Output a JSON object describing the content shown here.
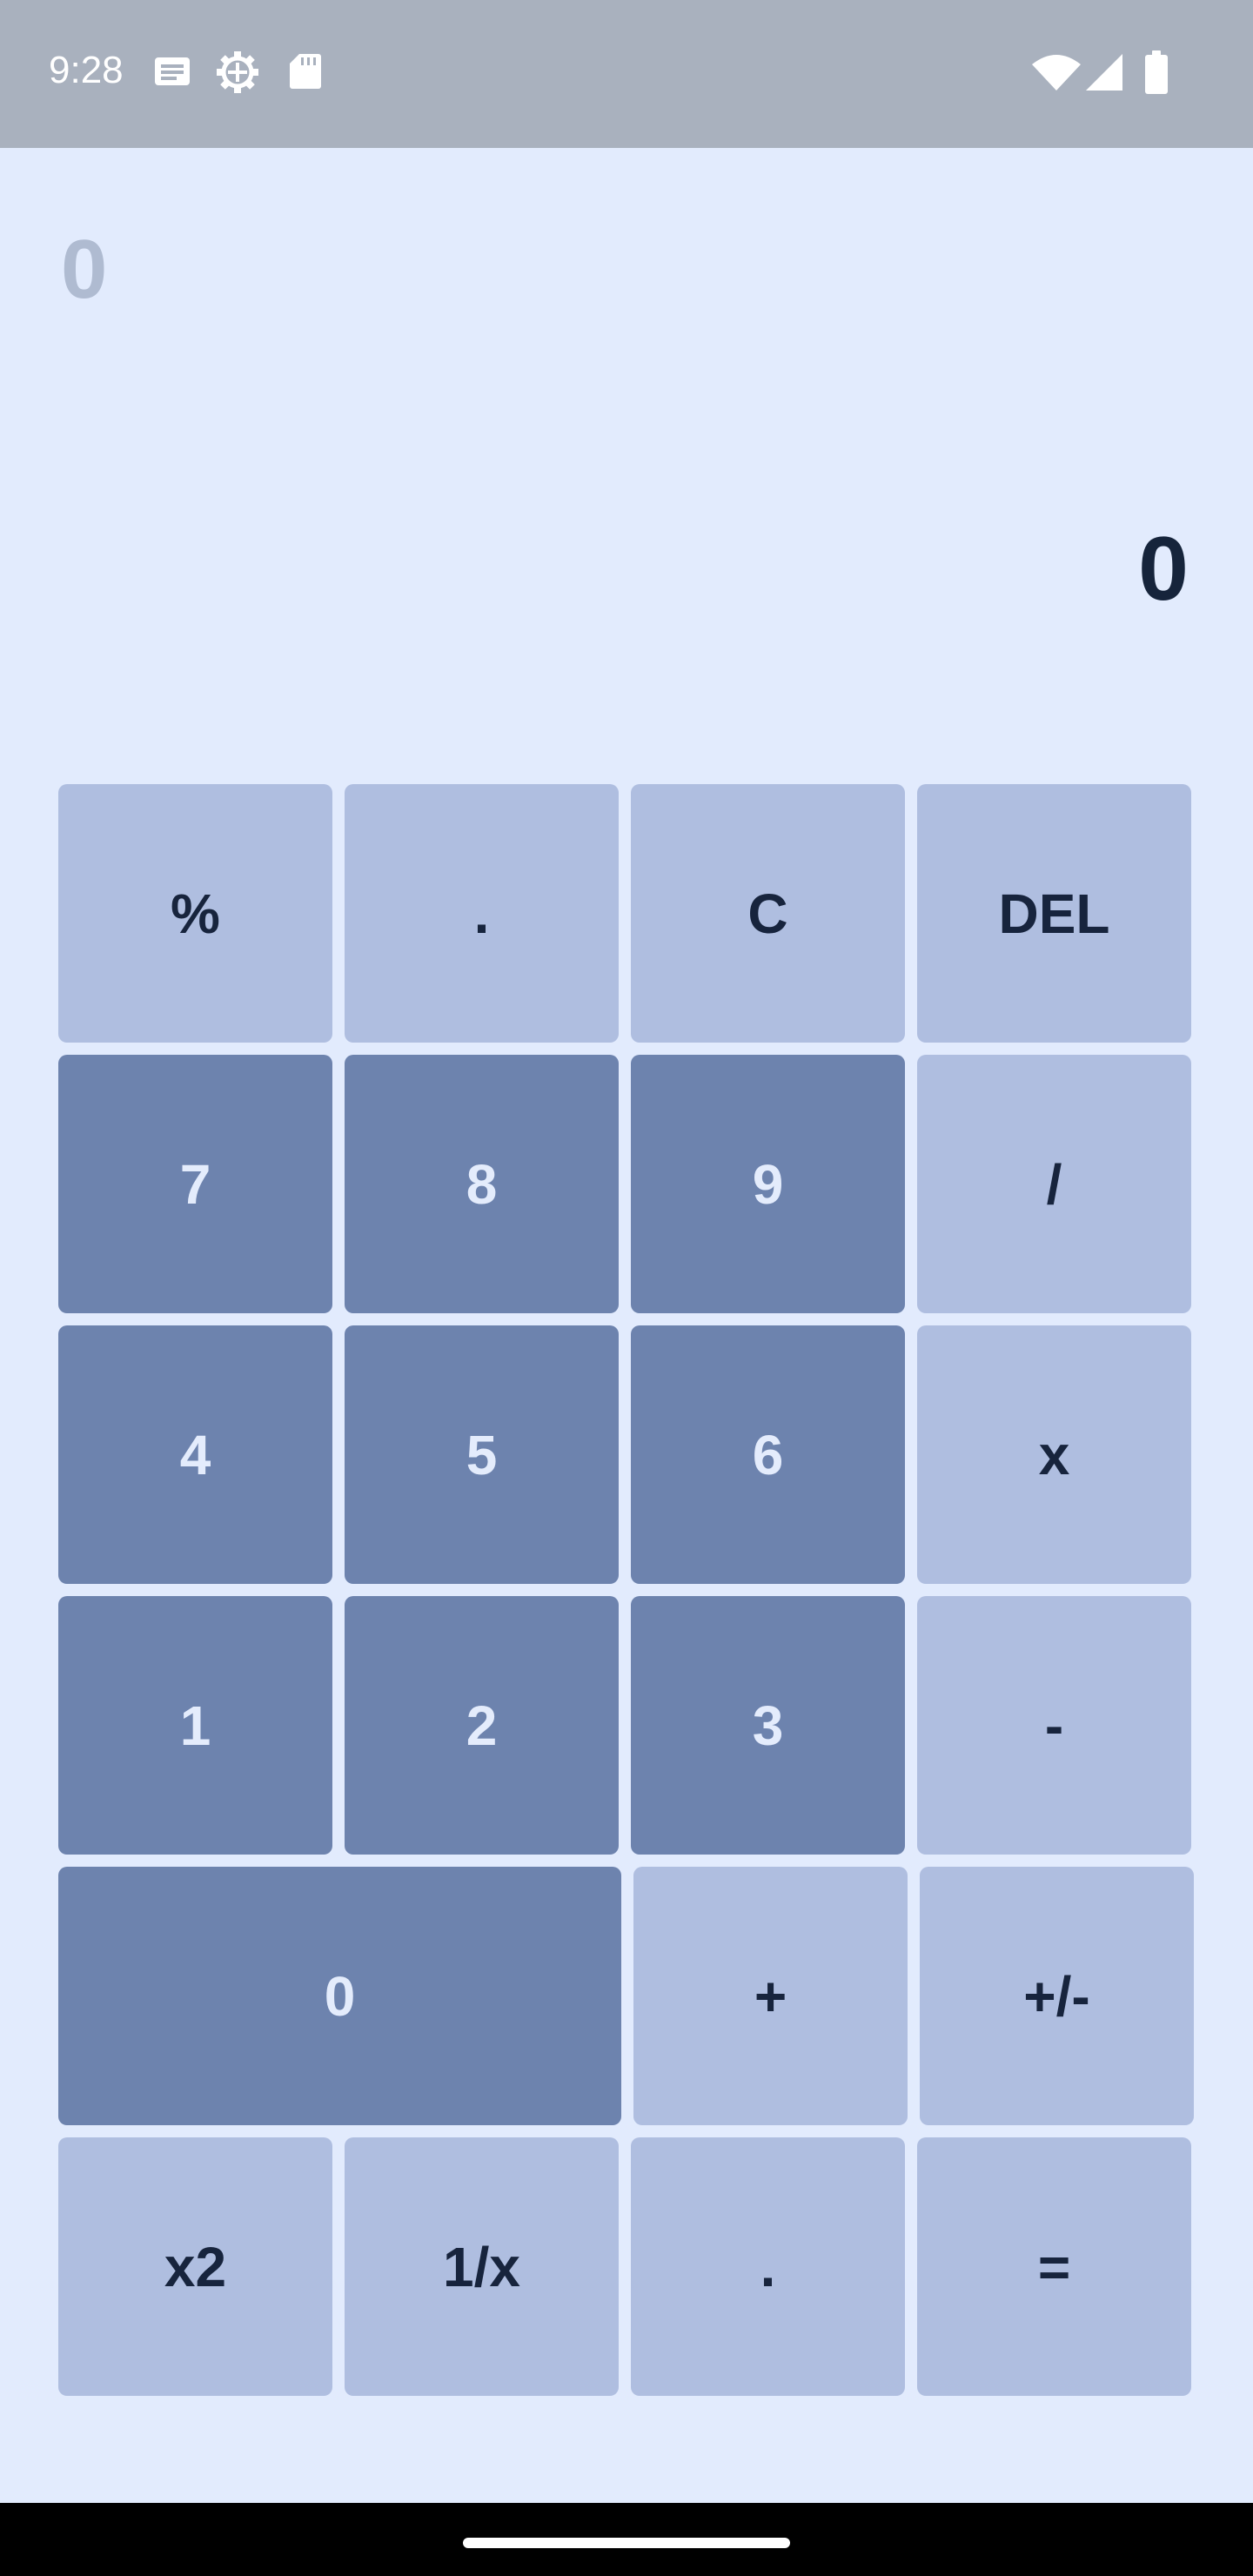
{
  "status_bar": {
    "time": "9:28",
    "left_icons": [
      "notification-icon",
      "settings-gear-icon",
      "sd-card-icon"
    ],
    "right_icons": [
      "wifi-icon",
      "cell-signal-icon",
      "battery-icon"
    ]
  },
  "display": {
    "expression": "0",
    "result": "0"
  },
  "keys": {
    "percent": "%",
    "decimal_top": ".",
    "clear": "C",
    "delete": "DEL",
    "seven": "7",
    "eight": "8",
    "nine": "9",
    "divide": "/",
    "four": "4",
    "five": "5",
    "six": "6",
    "multiply": "x",
    "one": "1",
    "two": "2",
    "three": "3",
    "minus": "-",
    "zero": "0",
    "plus": "+",
    "negate": "+/-",
    "square": "x2",
    "reciprocal": "1/x",
    "decimal_bottom": ".",
    "equals": "="
  },
  "colors": {
    "background": "#E2EBFD",
    "status_bar": "#A9B1BE",
    "key_light": "#AFBEE0",
    "key_dark": "#6D83AE",
    "text_dark": "#16243B",
    "expression_text": "#AFBBD1"
  }
}
